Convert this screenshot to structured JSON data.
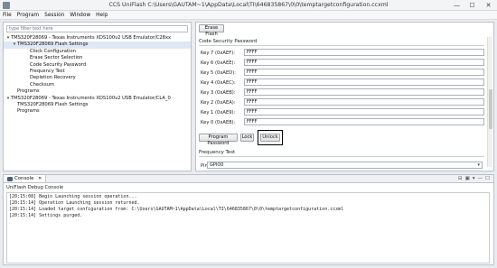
{
  "window": {
    "title": "CCS UniFlash C:\\Users\\GAUTAM~1\\AppData\\Local\\TI\\646835867\\0\\0\\temptargetconfiguration.ccxml",
    "minimize": "—",
    "maximize": "☐",
    "close": "✕"
  },
  "menu": [
    "File",
    "Program",
    "Session",
    "Window",
    "Help"
  ],
  "left": {
    "filter_placeholder": "type filter text here",
    "tree": [
      {
        "label": "TMS320F28069 - Texas Instruments XDS100v2 USB Emulator/C28xx",
        "level": 0,
        "toggle": "▾"
      },
      {
        "label": "TMS320F28069 Flash Settings",
        "level": 1,
        "toggle": "▾",
        "selected": true
      },
      {
        "label": "Clock Configuration",
        "level": 2,
        "toggle": ""
      },
      {
        "label": "Erase Sector Selection",
        "level": 2,
        "toggle": ""
      },
      {
        "label": "Code Security Password",
        "level": 2,
        "toggle": ""
      },
      {
        "label": "Frequency Test",
        "level": 2,
        "toggle": ""
      },
      {
        "label": "Depletion Recovery",
        "level": 2,
        "toggle": ""
      },
      {
        "label": "Checksum",
        "level": 2,
        "toggle": ""
      },
      {
        "label": "Programs",
        "level": 1,
        "toggle": ""
      },
      {
        "label": "TMS320F28069 - Texas Instruments XDS100v2 USB Emulator/CLA_0",
        "level": 0,
        "toggle": "▾"
      },
      {
        "label": "TMS320F28069 Flash Settings",
        "level": 1,
        "toggle": ""
      },
      {
        "label": "Programs",
        "level": 1,
        "toggle": ""
      }
    ]
  },
  "right": {
    "erase_flash": "Erase Flash",
    "csp_title": "Code Security Password",
    "keys": [
      {
        "label": "Key 7 (0xAEF):",
        "value": "FFFF"
      },
      {
        "label": "Key 6 (0xAEE):",
        "value": "FFFF"
      },
      {
        "label": "Key 5 (0xAED):",
        "value": "FFFF"
      },
      {
        "label": "Key 4 (0xAEC):",
        "value": "FFFF"
      },
      {
        "label": "Key 3 (0xAEB):",
        "value": "FFFF"
      },
      {
        "label": "Key 2 (0xAEA):",
        "value": "FFFF"
      },
      {
        "label": "Key 1 (0xAE9):",
        "value": "FFFF"
      },
      {
        "label": "Key 0 (0xAE8):",
        "value": "FFFF"
      }
    ],
    "program_password": "Program Password",
    "lock": "Lock",
    "unlock": "Unlock",
    "freq_title": "Frequency Test",
    "pin_label": "Pin",
    "pin_value": "GPIO0",
    "pin_arrow": "▾"
  },
  "console": {
    "tab": "Console",
    "close": "✕",
    "tool_icons": [
      "⊟",
      "▣",
      "▾",
      "—",
      "☐"
    ],
    "title": "UniFlash Debug Console",
    "lines": [
      "[20:15:08] Begin Launching session operation...",
      "[20:15:14] Operation Launching session returned.",
      "[20:15:14] Loaded target configuration from: C:\\Users\\GAUTAM~1\\AppData\\Local\\TI\\646835867\\0\\0\\temptargetconfiguration.ccxml",
      "[20:15:14] Settings purged."
    ]
  }
}
